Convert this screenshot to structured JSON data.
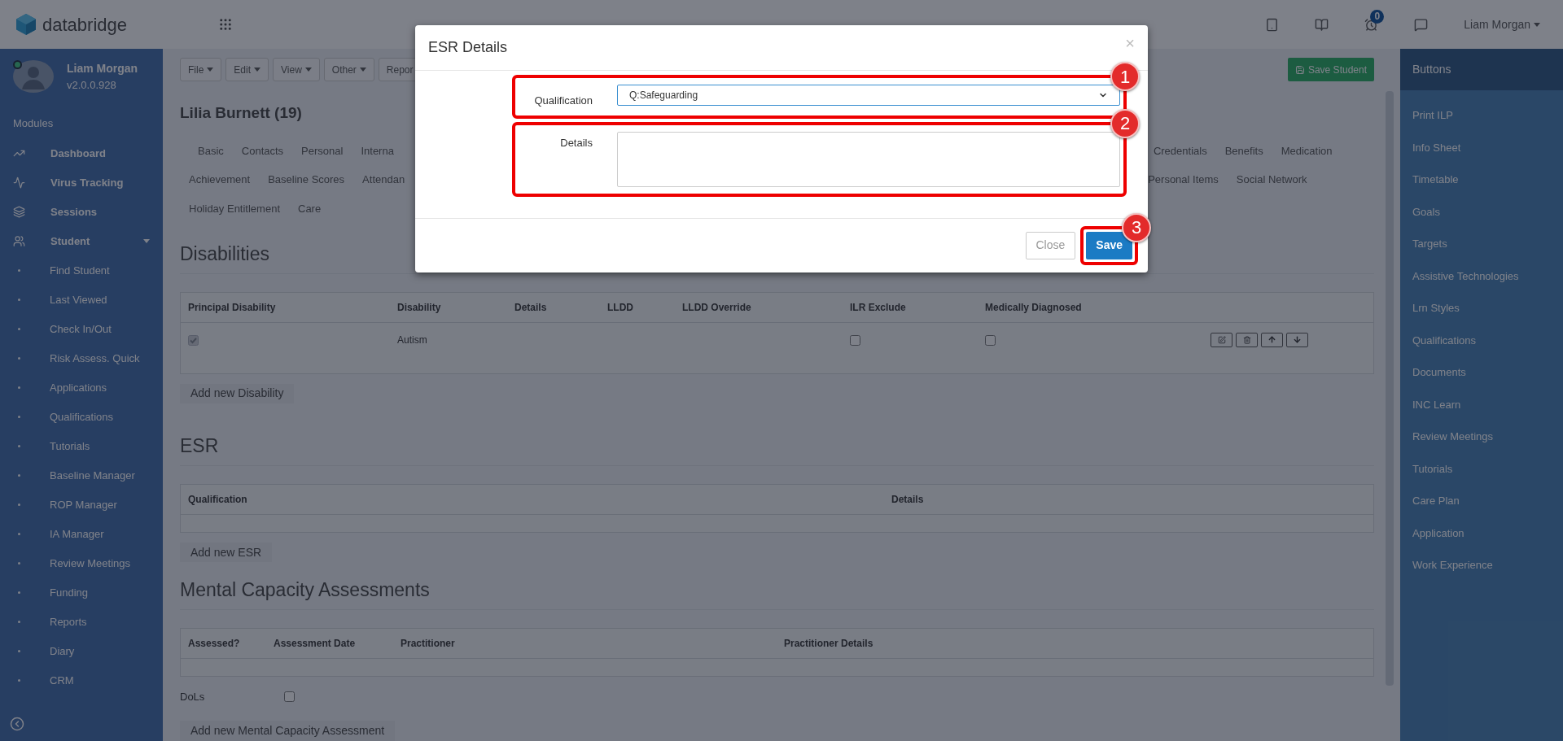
{
  "header": {
    "logo": "databridge",
    "alarm_badge": "0",
    "user": "Liam Morgan"
  },
  "profile": {
    "name": "Liam Morgan",
    "version": "v2.0.0.928",
    "online": true
  },
  "modules_label": "Modules",
  "nav": [
    {
      "label": "Dashboard",
      "kind": "chart"
    },
    {
      "label": "Virus Tracking",
      "kind": "pulse"
    },
    {
      "label": "Sessions",
      "kind": "layers"
    },
    {
      "label": "Student",
      "kind": "people",
      "expanded": true,
      "children": [
        {
          "label": "Find Student"
        },
        {
          "label": "Last Viewed"
        },
        {
          "label": "Check In/Out"
        },
        {
          "label": "Risk Assess. Quick"
        },
        {
          "label": "Applications"
        },
        {
          "label": "Qualifications"
        },
        {
          "label": "Tutorials"
        },
        {
          "label": "Baseline Manager"
        },
        {
          "label": "ROP Manager"
        },
        {
          "label": "IA Manager"
        },
        {
          "label": "Review Meetings"
        },
        {
          "label": "Funding"
        },
        {
          "label": "Reports"
        },
        {
          "label": "Diary"
        },
        {
          "label": "CRM"
        }
      ]
    }
  ],
  "toolbar": {
    "menus": [
      {
        "label": "File",
        "caret": true
      },
      {
        "label": "Edit",
        "caret": true
      },
      {
        "label": "View",
        "caret": true
      },
      {
        "label": "Other",
        "caret": true
      },
      {
        "label": "Repor",
        "caret": false
      }
    ],
    "save": "Save Student"
  },
  "student": {
    "title": "Lilia Burnett (19)"
  },
  "tab_rows": [
    [
      {
        "label": "Basic",
        "cut": false
      },
      {
        "label": "Contacts",
        "cut": false
      },
      {
        "label": "Personal",
        "cut": false
      },
      {
        "label": "Interna",
        "cut": true
      },
      {
        "label": "Credentials",
        "cut": false
      },
      {
        "label": "Benefits",
        "cut": false
      },
      {
        "label": "Medication",
        "cut": false
      }
    ],
    [
      {
        "label": "Achievement",
        "cut": false
      },
      {
        "label": "Baseline Scores",
        "cut": false
      },
      {
        "label": "Attendan",
        "cut": true
      },
      {
        "label": "Personal Items",
        "cut": false
      },
      {
        "label": "Social Network",
        "cut": false
      }
    ],
    [
      {
        "label": "Holiday Entitlement",
        "cut": false
      },
      {
        "label": "Care",
        "cut": false
      }
    ]
  ],
  "disabilities": {
    "heading": "Disabilities",
    "columns": [
      "Principal Disability",
      "Disability",
      "Details",
      "LLDD",
      "LLDD Override",
      "ILR Exclude",
      "Medically Diagnosed"
    ],
    "rows": [
      {
        "principal": true,
        "disability": "Autism",
        "ilr_exclude": false,
        "medically_diagnosed": false
      }
    ],
    "add": "Add new Disability"
  },
  "esr": {
    "heading": "ESR",
    "columns": [
      "Qualification",
      "Details"
    ],
    "add": "Add new ESR"
  },
  "mca": {
    "heading": "Mental Capacity Assessments",
    "columns": [
      "Assessed?",
      "Assessment Date",
      "Practitioner",
      "Practitioner Details"
    ],
    "dols_label": "DoLs",
    "dols_checked": false,
    "add": "Add new Mental Capacity Assessment"
  },
  "right_panel": {
    "heading": "Buttons",
    "items": [
      "Print ILP",
      "Info Sheet",
      "Timetable",
      "Goals",
      "Targets",
      "Assistive Technologies",
      "Lrn Styles",
      "Qualifications",
      "Documents",
      "INC Learn",
      "Review Meetings",
      "Tutorials",
      "Care Plan",
      "Application",
      "Work Experience"
    ]
  },
  "modal": {
    "title": "ESR Details",
    "close": "×",
    "fields": [
      {
        "label": "Qualification",
        "kind": "select",
        "value": "Q:Safeguarding",
        "annotation": "1"
      },
      {
        "label": "Details",
        "kind": "textarea",
        "annotation": "2"
      }
    ],
    "buttons": [
      {
        "label": "Close",
        "kind": "default"
      },
      {
        "label": "Save",
        "kind": "primary",
        "annotation": "3"
      }
    ]
  }
}
